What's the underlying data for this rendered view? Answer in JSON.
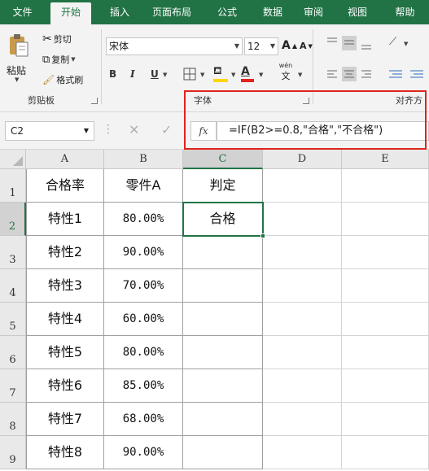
{
  "menu": {
    "items": [
      "文件",
      "开始",
      "插入",
      "页面布局",
      "公式",
      "数据",
      "审阅",
      "视图",
      "帮助"
    ],
    "active_index": 1
  },
  "ribbon": {
    "clipboard": {
      "paste": "粘贴",
      "cut": "剪切",
      "copy": "复制",
      "format_painter": "格式刷",
      "group_label": "剪贴板"
    },
    "font": {
      "font_name": "宋体",
      "font_size": "12",
      "bold": "B",
      "italic": "I",
      "underline": "U",
      "increase_size": "A",
      "decrease_size": "A",
      "phonetic": "wén",
      "phonetic_char": "文",
      "group_label": "字体"
    },
    "alignment": {
      "group_label": "对齐方"
    }
  },
  "formula_bar": {
    "name_box": "C2",
    "formula": "=IF(B2>=0.8,\"合格\",\"不合格\")",
    "fx": "fx"
  },
  "sheet": {
    "columns": [
      "A",
      "B",
      "C",
      "D",
      "E"
    ],
    "row_numbers": [
      "1",
      "2",
      "3",
      "4",
      "5",
      "6",
      "7",
      "8",
      "9"
    ],
    "active_cell": "C2",
    "rows": [
      [
        "合格率",
        "零件A",
        "判定"
      ],
      [
        "特性1",
        "80.00%",
        "合格"
      ],
      [
        "特性2",
        "90.00%",
        ""
      ],
      [
        "特性3",
        "70.00%",
        ""
      ],
      [
        "特性4",
        "60.00%",
        ""
      ],
      [
        "特性5",
        "80.00%",
        ""
      ],
      [
        "特性6",
        "85.00%",
        ""
      ],
      [
        "特性7",
        "68.00%",
        ""
      ],
      [
        "特性8",
        "90.00%",
        ""
      ]
    ]
  },
  "colors": {
    "excel_green": "#217346",
    "highlight_red": "#e0241b"
  }
}
